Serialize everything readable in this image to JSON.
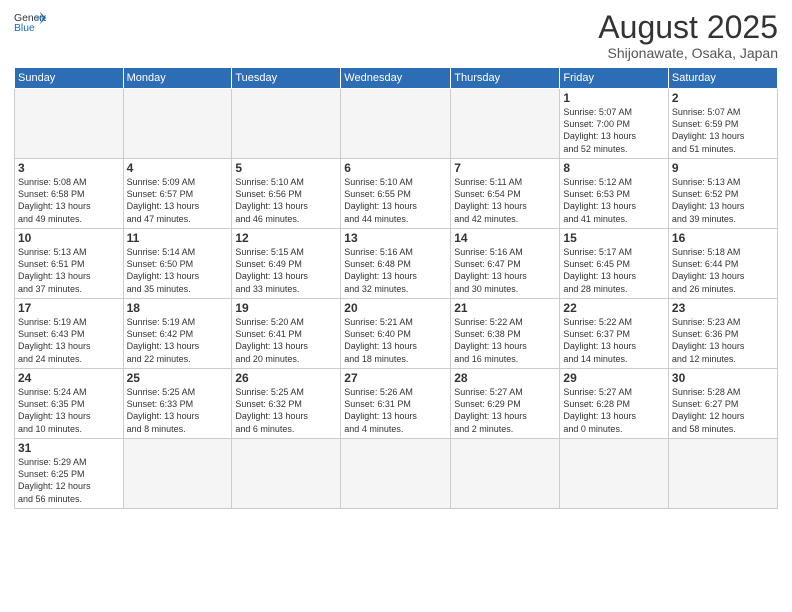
{
  "logo": {
    "text_general": "General",
    "text_blue": "Blue"
  },
  "header": {
    "month_year": "August 2025",
    "location": "Shijonawate, Osaka, Japan"
  },
  "weekdays": [
    "Sunday",
    "Monday",
    "Tuesday",
    "Wednesday",
    "Thursday",
    "Friday",
    "Saturday"
  ],
  "weeks": [
    [
      {
        "day": "",
        "info": ""
      },
      {
        "day": "",
        "info": ""
      },
      {
        "day": "",
        "info": ""
      },
      {
        "day": "",
        "info": ""
      },
      {
        "day": "",
        "info": ""
      },
      {
        "day": "1",
        "info": "Sunrise: 5:07 AM\nSunset: 7:00 PM\nDaylight: 13 hours\nand 52 minutes."
      },
      {
        "day": "2",
        "info": "Sunrise: 5:07 AM\nSunset: 6:59 PM\nDaylight: 13 hours\nand 51 minutes."
      }
    ],
    [
      {
        "day": "3",
        "info": "Sunrise: 5:08 AM\nSunset: 6:58 PM\nDaylight: 13 hours\nand 49 minutes."
      },
      {
        "day": "4",
        "info": "Sunrise: 5:09 AM\nSunset: 6:57 PM\nDaylight: 13 hours\nand 47 minutes."
      },
      {
        "day": "5",
        "info": "Sunrise: 5:10 AM\nSunset: 6:56 PM\nDaylight: 13 hours\nand 46 minutes."
      },
      {
        "day": "6",
        "info": "Sunrise: 5:10 AM\nSunset: 6:55 PM\nDaylight: 13 hours\nand 44 minutes."
      },
      {
        "day": "7",
        "info": "Sunrise: 5:11 AM\nSunset: 6:54 PM\nDaylight: 13 hours\nand 42 minutes."
      },
      {
        "day": "8",
        "info": "Sunrise: 5:12 AM\nSunset: 6:53 PM\nDaylight: 13 hours\nand 41 minutes."
      },
      {
        "day": "9",
        "info": "Sunrise: 5:13 AM\nSunset: 6:52 PM\nDaylight: 13 hours\nand 39 minutes."
      }
    ],
    [
      {
        "day": "10",
        "info": "Sunrise: 5:13 AM\nSunset: 6:51 PM\nDaylight: 13 hours\nand 37 minutes."
      },
      {
        "day": "11",
        "info": "Sunrise: 5:14 AM\nSunset: 6:50 PM\nDaylight: 13 hours\nand 35 minutes."
      },
      {
        "day": "12",
        "info": "Sunrise: 5:15 AM\nSunset: 6:49 PM\nDaylight: 13 hours\nand 33 minutes."
      },
      {
        "day": "13",
        "info": "Sunrise: 5:16 AM\nSunset: 6:48 PM\nDaylight: 13 hours\nand 32 minutes."
      },
      {
        "day": "14",
        "info": "Sunrise: 5:16 AM\nSunset: 6:47 PM\nDaylight: 13 hours\nand 30 minutes."
      },
      {
        "day": "15",
        "info": "Sunrise: 5:17 AM\nSunset: 6:45 PM\nDaylight: 13 hours\nand 28 minutes."
      },
      {
        "day": "16",
        "info": "Sunrise: 5:18 AM\nSunset: 6:44 PM\nDaylight: 13 hours\nand 26 minutes."
      }
    ],
    [
      {
        "day": "17",
        "info": "Sunrise: 5:19 AM\nSunset: 6:43 PM\nDaylight: 13 hours\nand 24 minutes."
      },
      {
        "day": "18",
        "info": "Sunrise: 5:19 AM\nSunset: 6:42 PM\nDaylight: 13 hours\nand 22 minutes."
      },
      {
        "day": "19",
        "info": "Sunrise: 5:20 AM\nSunset: 6:41 PM\nDaylight: 13 hours\nand 20 minutes."
      },
      {
        "day": "20",
        "info": "Sunrise: 5:21 AM\nSunset: 6:40 PM\nDaylight: 13 hours\nand 18 minutes."
      },
      {
        "day": "21",
        "info": "Sunrise: 5:22 AM\nSunset: 6:38 PM\nDaylight: 13 hours\nand 16 minutes."
      },
      {
        "day": "22",
        "info": "Sunrise: 5:22 AM\nSunset: 6:37 PM\nDaylight: 13 hours\nand 14 minutes."
      },
      {
        "day": "23",
        "info": "Sunrise: 5:23 AM\nSunset: 6:36 PM\nDaylight: 13 hours\nand 12 minutes."
      }
    ],
    [
      {
        "day": "24",
        "info": "Sunrise: 5:24 AM\nSunset: 6:35 PM\nDaylight: 13 hours\nand 10 minutes."
      },
      {
        "day": "25",
        "info": "Sunrise: 5:25 AM\nSunset: 6:33 PM\nDaylight: 13 hours\nand 8 minutes."
      },
      {
        "day": "26",
        "info": "Sunrise: 5:25 AM\nSunset: 6:32 PM\nDaylight: 13 hours\nand 6 minutes."
      },
      {
        "day": "27",
        "info": "Sunrise: 5:26 AM\nSunset: 6:31 PM\nDaylight: 13 hours\nand 4 minutes."
      },
      {
        "day": "28",
        "info": "Sunrise: 5:27 AM\nSunset: 6:29 PM\nDaylight: 13 hours\nand 2 minutes."
      },
      {
        "day": "29",
        "info": "Sunrise: 5:27 AM\nSunset: 6:28 PM\nDaylight: 13 hours\nand 0 minutes."
      },
      {
        "day": "30",
        "info": "Sunrise: 5:28 AM\nSunset: 6:27 PM\nDaylight: 12 hours\nand 58 minutes."
      }
    ],
    [
      {
        "day": "31",
        "info": "Sunrise: 5:29 AM\nSunset: 6:25 PM\nDaylight: 12 hours\nand 56 minutes."
      },
      {
        "day": "",
        "info": ""
      },
      {
        "day": "",
        "info": ""
      },
      {
        "day": "",
        "info": ""
      },
      {
        "day": "",
        "info": ""
      },
      {
        "day": "",
        "info": ""
      },
      {
        "day": "",
        "info": ""
      }
    ]
  ]
}
